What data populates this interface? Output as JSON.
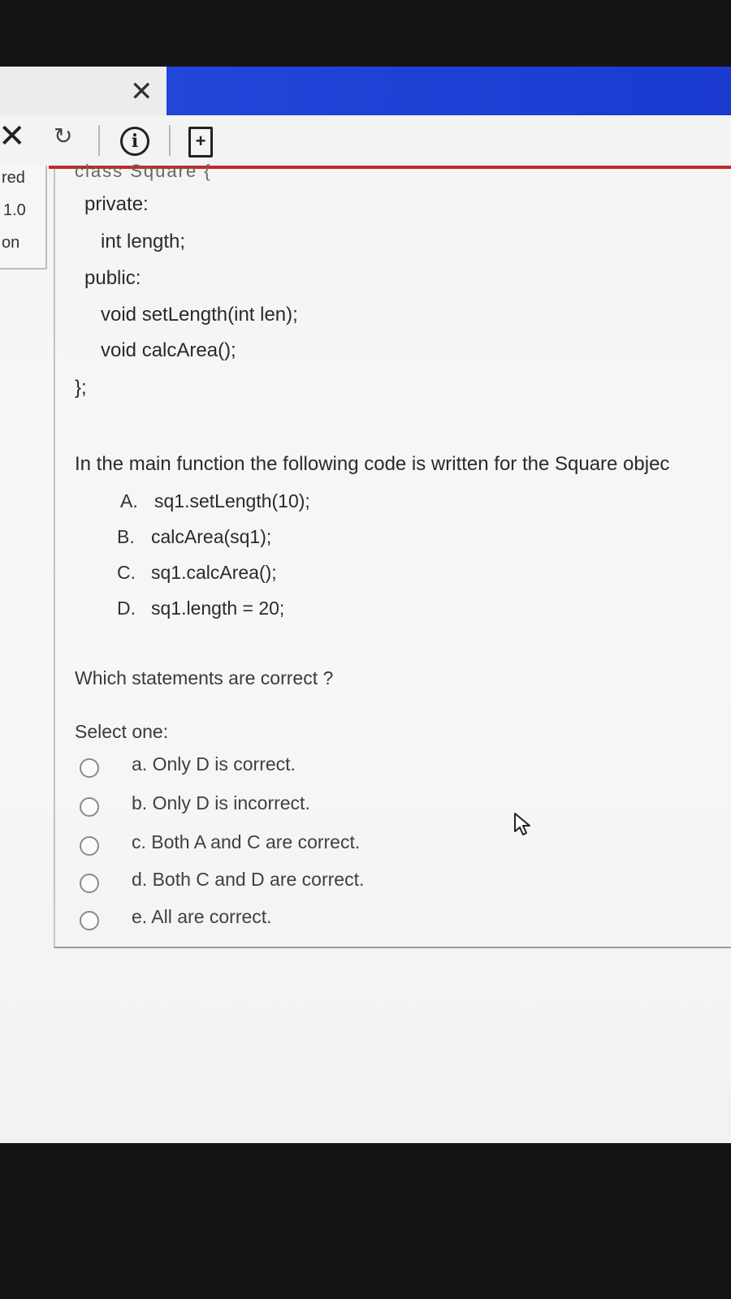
{
  "browser": {
    "tab_close_icon": "close-icon",
    "toolbar_icons": [
      "stop-icon",
      "reload-icon",
      "info-icon",
      "page-icon"
    ]
  },
  "side_panel": {
    "lines": [
      "red",
      "1.0",
      "on"
    ]
  },
  "question": {
    "cut_header": "class Square {",
    "code_lines": [
      "private:",
      "int length;",
      "public:",
      "void setLength(int len);",
      "void calcArea();",
      "};"
    ],
    "intro": "In the main function the following code is written for the Square objec",
    "statements": [
      {
        "letter": "A.",
        "code": "sq1.setLength(10);"
      },
      {
        "letter": "B.",
        "code": "calcArea(sq1);"
      },
      {
        "letter": "C.",
        "code": "sq1.calcArea();"
      },
      {
        "letter": "D.",
        "code": "sq1.length = 20;"
      }
    ],
    "ask": "Which statements are correct ?",
    "select_label": "Select one:",
    "answers": [
      "a. Only D is correct.",
      "b. Only D is incorrect.",
      "c. Both A and C are correct.",
      "d. Both C and D are correct.",
      "e. All are correct."
    ]
  },
  "colors": {
    "tab_blue": "#1e3fd6",
    "accent_red": "#c02a2a"
  }
}
